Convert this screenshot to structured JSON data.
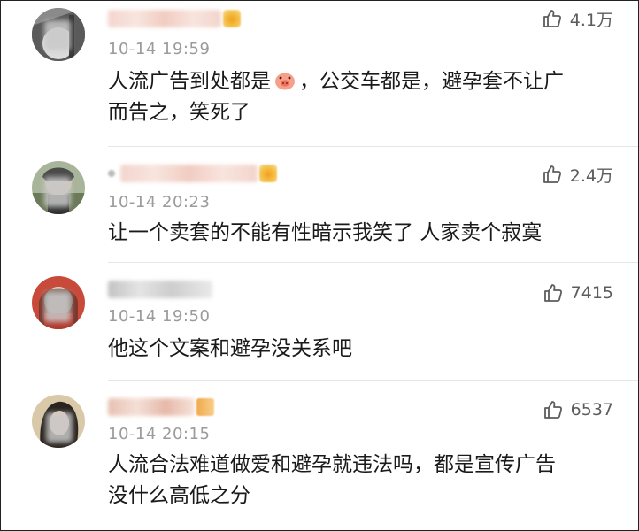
{
  "comments": [
    {
      "timestamp": "10-14 19:59",
      "likes": "4.1万",
      "content": [
        "人流广告到处都是",
        "，公交车都是，避孕套不让广",
        "而告之，笑死了"
      ],
      "emoji_icon": "pig-face-emoji-icon"
    },
    {
      "timestamp": "10-14 20:23",
      "likes": "2.4万",
      "content": [
        "让一个卖套的不能有性暗示我笑了 人家卖个寂寞"
      ]
    },
    {
      "timestamp": "10-14 19:50",
      "likes": "7415",
      "content": [
        "他这个文案和避孕没关系吧"
      ]
    },
    {
      "timestamp": "10-14 20:15",
      "likes": "6537",
      "content": [
        "人流合法难道做爱和避孕就违法吗，都是宣传广告",
        "没什么高低之分"
      ]
    }
  ],
  "colors": {
    "text": "#1a1a1a",
    "meta": "#9b9b9b",
    "like": "#5c5c5c",
    "divider": "#e6e6e6"
  },
  "icons": {
    "like": "thumbs-up-icon",
    "badge": "vip-crown-icon"
  }
}
